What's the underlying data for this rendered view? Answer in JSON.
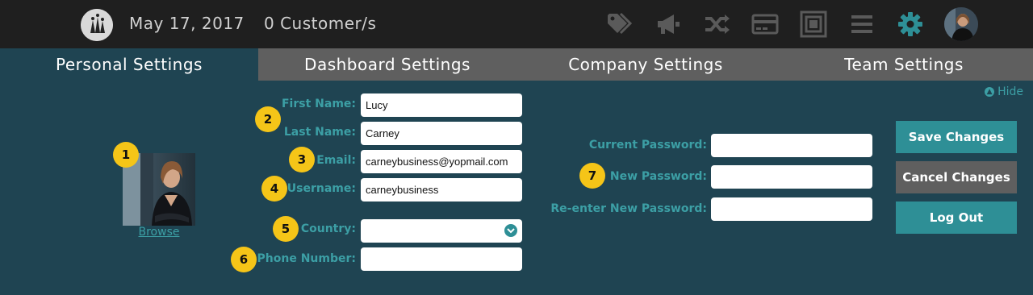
{
  "header": {
    "date": "May 17, 2017",
    "customers": "0 Customer/s",
    "icons": [
      "tags-icon",
      "megaphone-icon",
      "shuffle-icon",
      "credit-card-icon",
      "layers-icon",
      "menu-icon",
      "gear-icon",
      "user-avatar"
    ],
    "active_icon_color": "#2e8f96"
  },
  "tabs": [
    {
      "label": "Personal Settings"
    },
    {
      "label": "Dashboard Settings"
    },
    {
      "label": "Company Settings"
    },
    {
      "label": "Team Settings"
    }
  ],
  "hide_label": "Hide",
  "profile": {
    "browse_label": "Browse"
  },
  "badges": [
    "1",
    "2",
    "3",
    "4",
    "5",
    "6",
    "7"
  ],
  "form": {
    "first_name_label": "First Name:",
    "first_name_value": "Lucy",
    "last_name_label": "Last Name:",
    "last_name_value": "Carney",
    "email_label": "Email:",
    "email_value": "carneybusiness@yopmail.com",
    "username_label": "Username:",
    "username_value": "carneybusiness",
    "country_label": "Country:",
    "country_value": "",
    "phone_label": "Phone Number:",
    "phone_value": ""
  },
  "password": {
    "current_label": "Current Password:",
    "new_label": "New Password:",
    "reenter_label": "Re-enter New Password:"
  },
  "buttons": {
    "save": "Save Changes",
    "cancel": "Cancel Changes",
    "logout": "Log Out"
  },
  "colors": {
    "background": "#1f4452",
    "topbar": "#1f1f1f",
    "tab_inactive": "#5f5f5f",
    "accent": "#3c9fa5",
    "button_teal": "#2e8f96",
    "badge": "#f5c518"
  }
}
